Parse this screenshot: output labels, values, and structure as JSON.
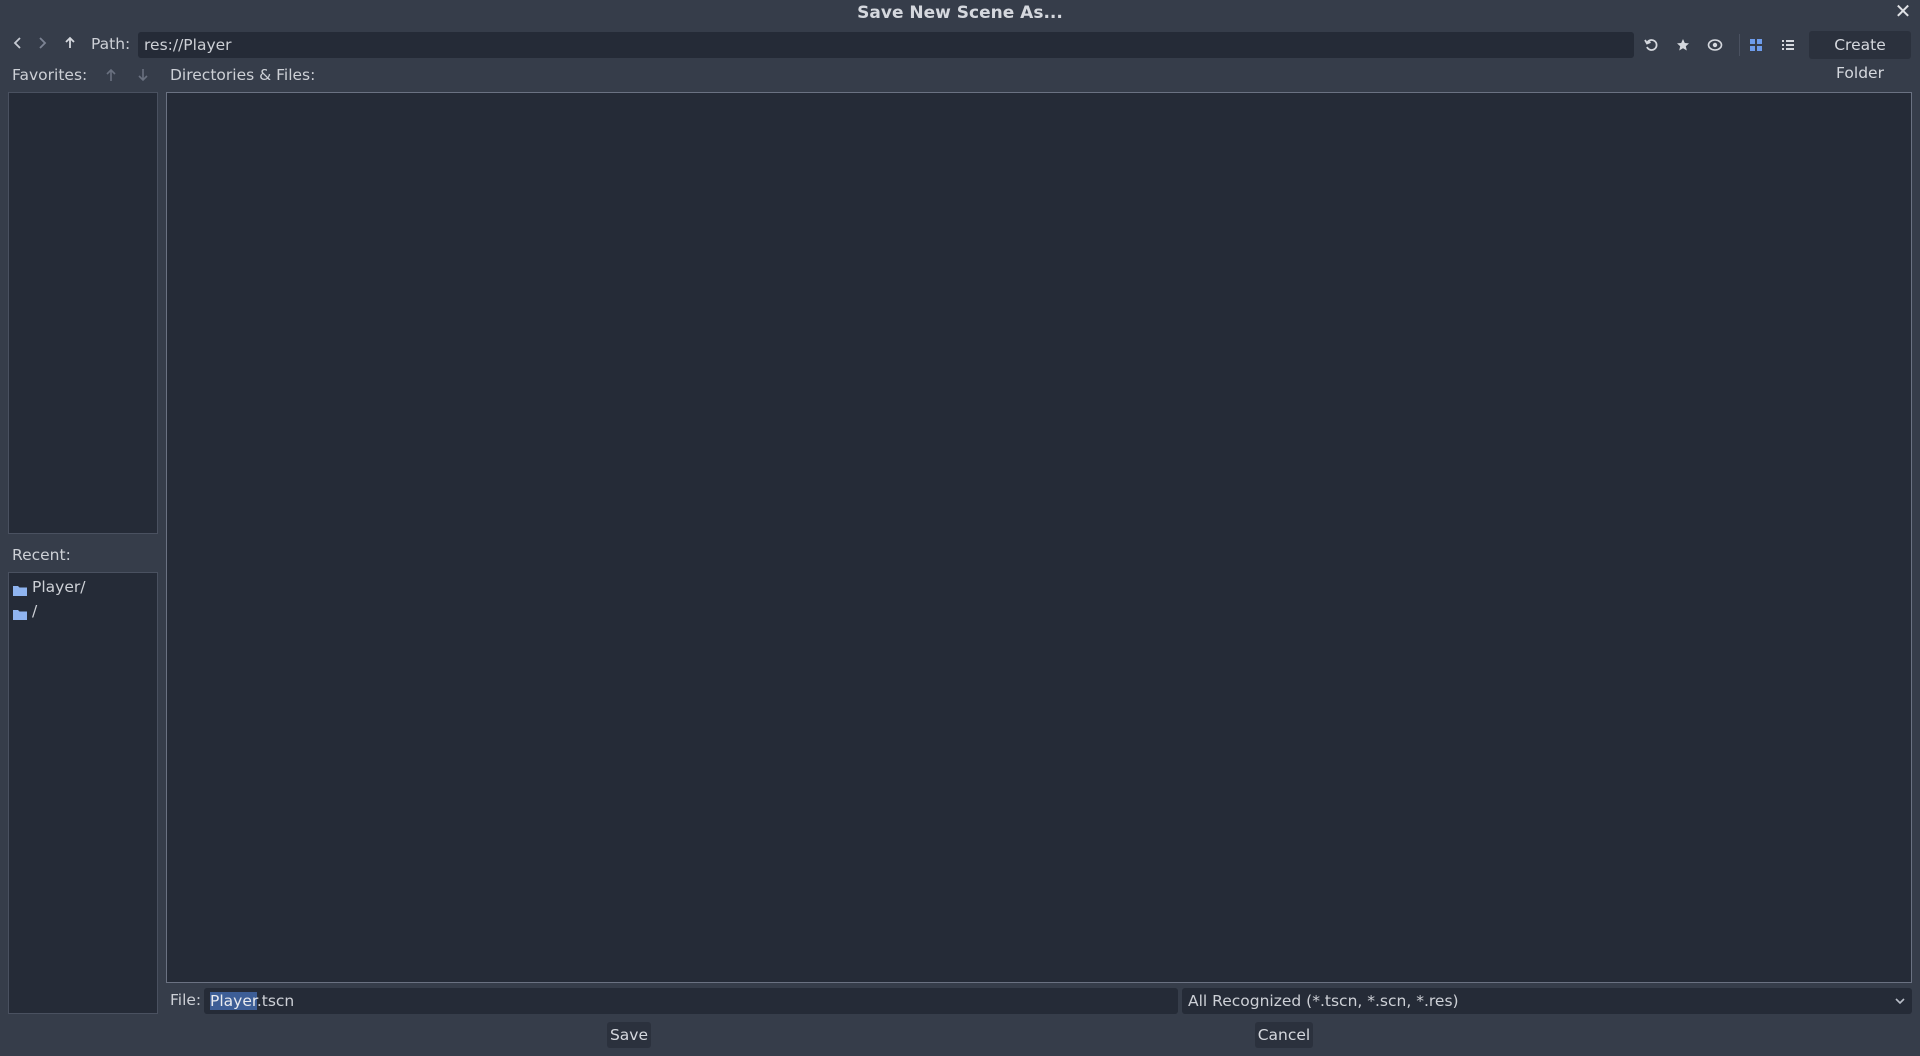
{
  "dialog": {
    "title": "Save New Scene As...",
    "close_icon": "close-icon"
  },
  "toolbar": {
    "back_icon": "chevron-left-icon",
    "forward_icon": "chevron-right-icon",
    "up_icon": "arrow-up-icon",
    "path_label": "Path:",
    "path_value": "res://Player",
    "refresh_icon": "refresh-icon",
    "favorite_icon": "star-icon",
    "hidden_icon": "eye-icon",
    "grid_view_icon": "grid-view-icon",
    "list_view_icon": "list-view-icon",
    "create_folder_label": "Create Folder"
  },
  "sidebar": {
    "favorites_label": "Favorites:",
    "recent_label": "Recent:",
    "recent_items": [
      {
        "label": "Player/",
        "icon": "folder-icon"
      },
      {
        "label": "/",
        "icon": "folder-icon"
      }
    ]
  },
  "main": {
    "files_label": "Directories & Files:"
  },
  "footer": {
    "file_label": "File:",
    "file_name_selected": "Player",
    "file_name_rest": ".tscn",
    "filter_value": "All Recognized (*.tscn, *.scn, *.res)",
    "save_label": "Save",
    "cancel_label": "Cancel"
  },
  "colors": {
    "background": "#363d4a",
    "panel": "#252b37",
    "accent": "#6e9ceb",
    "selection": "#3d5e96"
  }
}
